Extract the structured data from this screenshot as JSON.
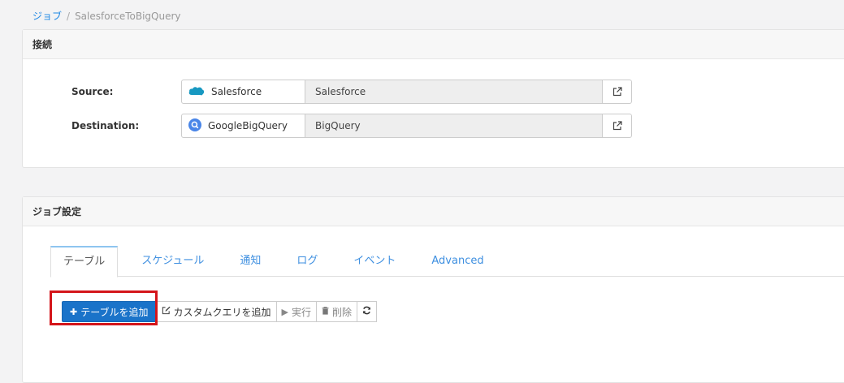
{
  "breadcrumb": {
    "root": "ジョブ",
    "separator": "/",
    "current": "SalesforceToBigQuery"
  },
  "connection": {
    "heading": "接続",
    "source": {
      "label": "Source:",
      "connector": "Salesforce",
      "name": "Salesforce",
      "icon": "salesforce-icon"
    },
    "destination": {
      "label": "Destination:",
      "connector": "GoogleBigQuery",
      "name": "BigQuery",
      "icon": "bigquery-icon"
    }
  },
  "job_settings": {
    "heading": "ジョブ設定",
    "tabs": [
      "テーブル",
      "スケジュール",
      "通知",
      "ログ",
      "イベント",
      "Advanced"
    ],
    "active_tab": "テーブル",
    "toolbar": {
      "add_table": "テーブルを追加",
      "add_custom_query": "カスタムクエリを追加",
      "run": "実行",
      "delete": "削除"
    }
  },
  "colors": {
    "accent": "#1a73c9",
    "highlight": "#d4151a",
    "link": "#1e88e5"
  }
}
